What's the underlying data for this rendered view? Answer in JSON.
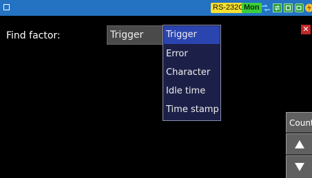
{
  "status_bar": {
    "interface_badge": "RS-232C",
    "mode_badge": "Mon",
    "badge_colors": {
      "interface": "#f5df2e",
      "mode": "#3ccf3c",
      "bar": "#2472c2"
    },
    "icons": [
      "menu-square-icon",
      "connection-icon",
      "transfer-icon",
      "storage-icon",
      "power-icon"
    ]
  },
  "form": {
    "find_factor_label": "Find factor:",
    "selected_value": "Trigger"
  },
  "dropdown": {
    "options": [
      "Trigger",
      "Error",
      "Character",
      "Idle time",
      "Time stamp"
    ],
    "selected_index": 0
  },
  "side_buttons": {
    "count_label": "Count",
    "up_icon": "up-triangle-icon",
    "down_icon": "down-triangle-icon"
  },
  "close_icon": "close-icon"
}
